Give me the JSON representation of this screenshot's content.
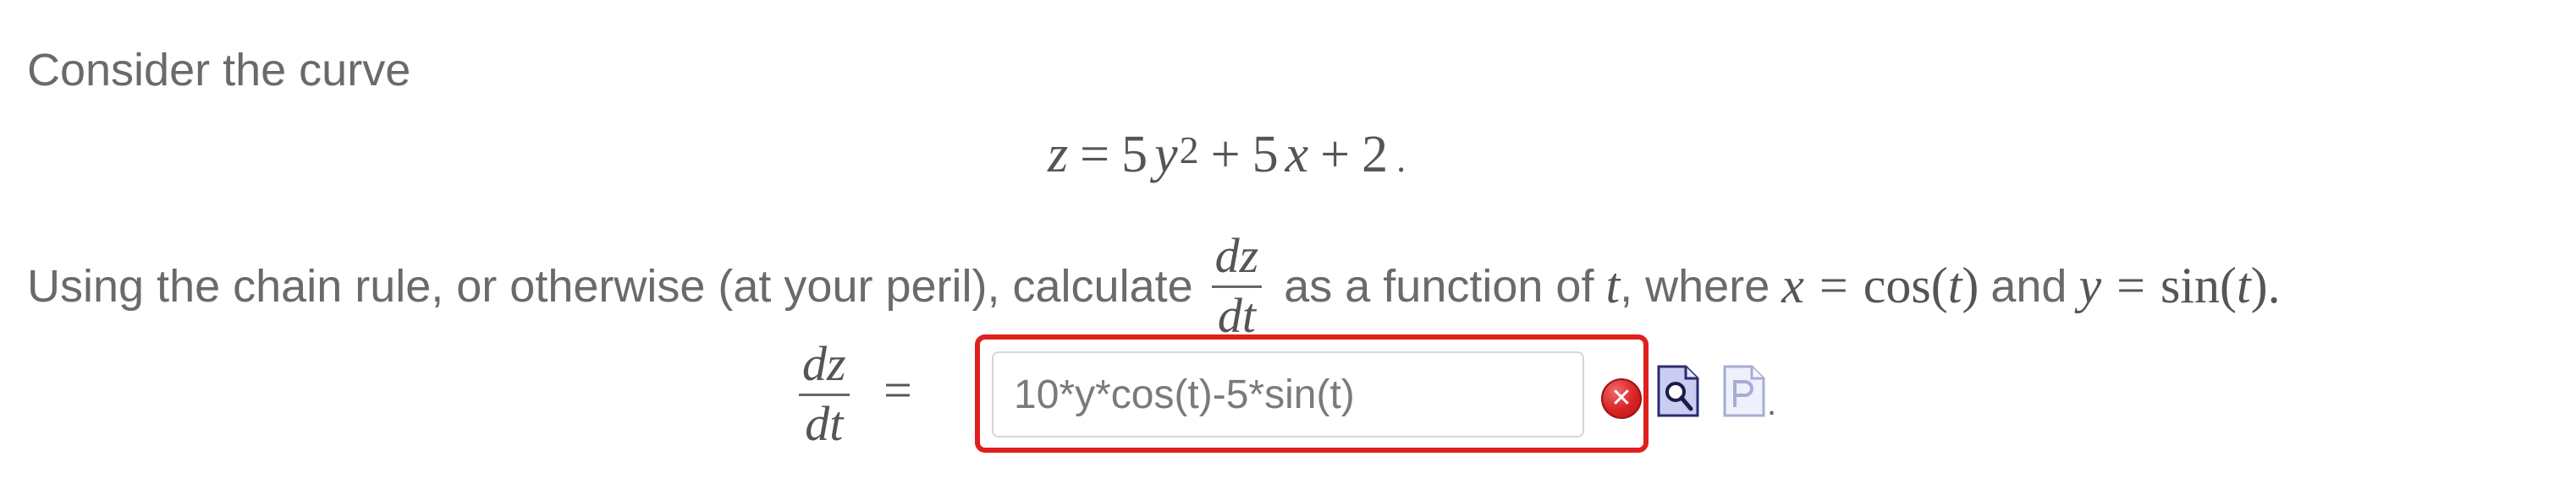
{
  "intro": "Consider the curve",
  "equation": {
    "lhs": "z",
    "eq": "=",
    "coef1": "5",
    "var1": "y",
    "exp1": "2",
    "plus1": "+",
    "coef2": "5",
    "var2": "x",
    "plus2": "+",
    "const": "2",
    "end": "."
  },
  "instruction": {
    "before": "Using the chain rule, or otherwise (at your peril), calculate",
    "frac_num": "dz",
    "frac_den": "dt",
    "middle": "as a function of",
    "t": "t",
    "where": ", where",
    "x": "x",
    "eq1": "=",
    "cos": "cos(",
    "t1": "t",
    "close1": ")",
    "and": "and",
    "y": "y",
    "eq2": "=",
    "sin": "sin(",
    "t2": "t",
    "close2": ")."
  },
  "answer": {
    "frac_num": "dz",
    "frac_den": "dt",
    "eq": "=",
    "input_value": "10*y*cos(t)-5*sin(t)",
    "status": "incorrect",
    "error_symbol": "✕",
    "trail": "."
  },
  "icons": {
    "error": "error-x-icon",
    "preview": "preview-document-magnifier-icon",
    "format": "format-help-document-icon"
  },
  "colors": {
    "error_border": "#e0201e",
    "text": "#6a6a6a"
  }
}
